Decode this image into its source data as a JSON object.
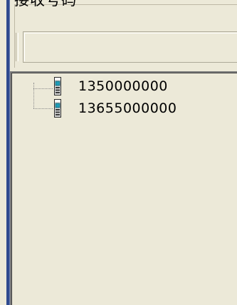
{
  "groupbox": {
    "title": "接收号码"
  },
  "recipient_input": {
    "value": ""
  },
  "tree": {
    "items": [
      {
        "label": "1350000000",
        "icon": "phone-icon"
      },
      {
        "label": "13655000000",
        "icon": "phone-icon"
      }
    ]
  },
  "colors": {
    "background": "#ECE9D8",
    "window_edge": "#2F4A8F",
    "icon_teal": "#1E9DB8"
  }
}
